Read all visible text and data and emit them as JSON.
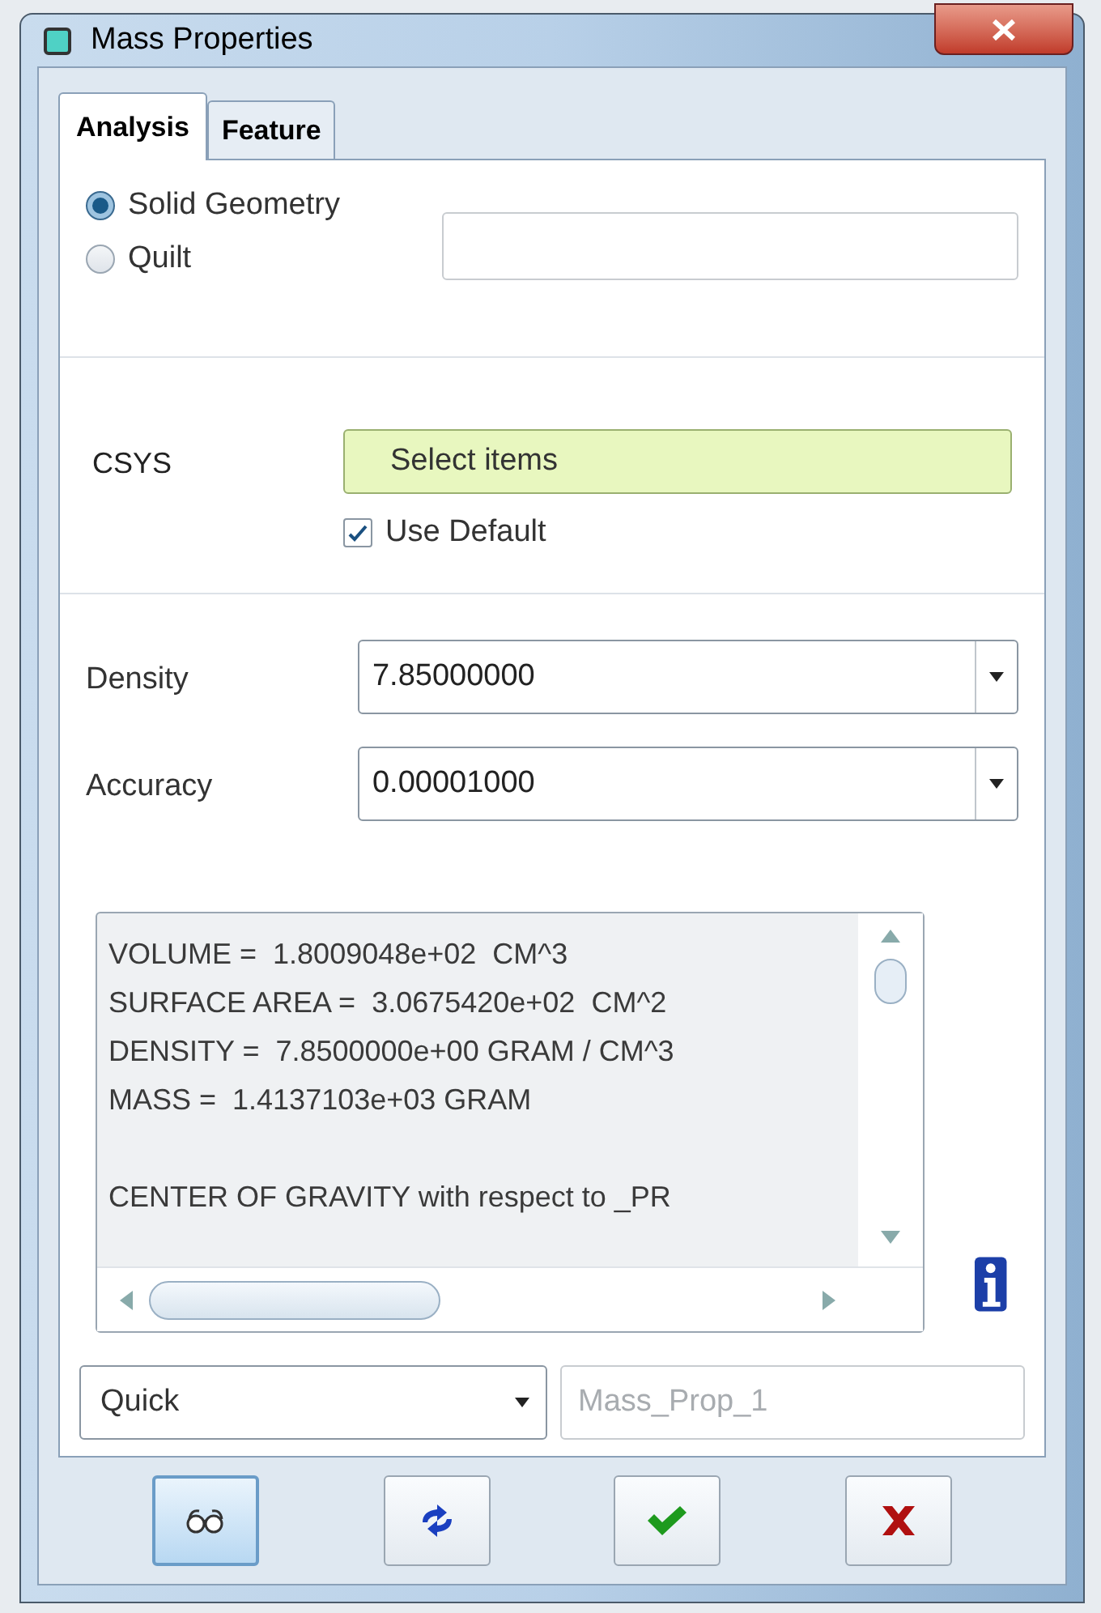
{
  "window": {
    "title": "Mass Properties"
  },
  "tabs": [
    {
      "label": "Analysis",
      "selected": true
    },
    {
      "label": "Feature",
      "selected": false
    }
  ],
  "geometry": {
    "options": [
      {
        "label": "Solid Geometry",
        "selected": true
      },
      {
        "label": "Quilt",
        "selected": false
      }
    ]
  },
  "csys": {
    "label": "CSYS",
    "field": "Select items",
    "use_default": {
      "label": "Use Default",
      "checked": true
    }
  },
  "density": {
    "label": "Density",
    "value": "7.85000000"
  },
  "accuracy": {
    "label": "Accuracy",
    "value": "0.00001000"
  },
  "results": {
    "paragraphs": [
      [
        "VOLUME =  1.8009048e+02  CM^3",
        "SURFACE AREA =  3.0675420e+02  CM^2",
        "DENSITY =  7.8500000e+00 GRAM / CM^3",
        "MASS =  1.4137103e+03 GRAM"
      ],
      [
        "CENTER OF GRAVITY with respect to _PR"
      ]
    ]
  },
  "mode": {
    "value": "Quick"
  },
  "feature_name": {
    "placeholder": "Mass_Prop_1"
  },
  "buttons": [
    {
      "kind": "preview",
      "pressed": true
    },
    {
      "kind": "repeat",
      "pressed": false
    },
    {
      "kind": "ok",
      "pressed": false
    },
    {
      "kind": "cancel",
      "pressed": false
    }
  ]
}
